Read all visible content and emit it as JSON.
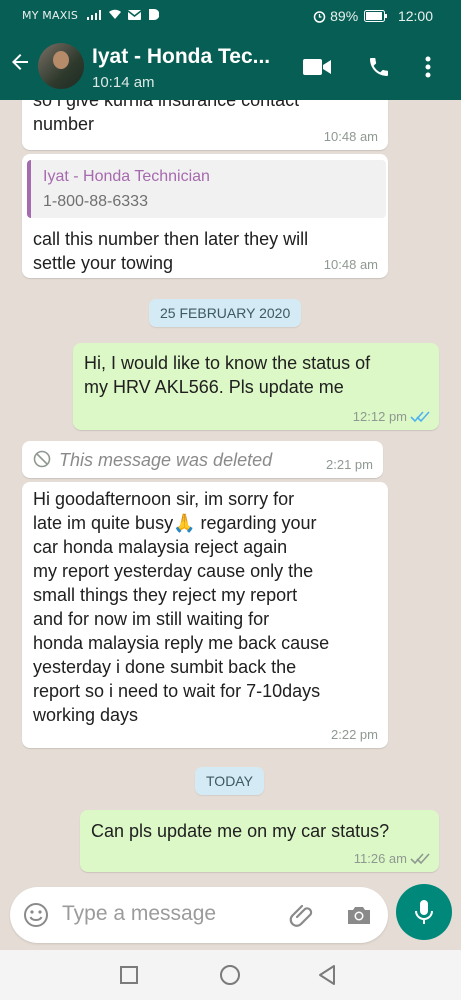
{
  "status_bar": {
    "carrier": "MY MAXIS",
    "battery": "89%",
    "time": "12:00"
  },
  "header": {
    "contact_name": "Iyat - Honda Tec...",
    "subtitle": "10:14 am"
  },
  "messages": [
    {
      "direction": "incoming",
      "text": "so i give kurnia insurance contact\nnumber",
      "time": "10:48 am"
    },
    {
      "direction": "incoming",
      "quoted": {
        "name": "Iyat - Honda Technician",
        "text": "1-800-88-6333"
      },
      "text": "call this number then later they will\nsettle your towing",
      "time": "10:48 am"
    },
    {
      "type": "date",
      "label": "25 FEBRUARY 2020"
    },
    {
      "direction": "outgoing",
      "text": "Hi, I would like to know the status of\nmy HRV AKL566. Pls update me",
      "time": "12:12 pm",
      "status": "read"
    },
    {
      "direction": "incoming",
      "deleted": true,
      "text": "This message was deleted",
      "time": "2:21 pm"
    },
    {
      "direction": "incoming",
      "text": "Hi goodafternoon sir, im sorry for\nlate im quite busy🙏 regarding your\ncar honda malaysia reject again\nmy report yesterday cause only the\nsmall things they reject my report\nand for now im still waiting for\nhonda malaysia reply me back cause\nyesterday i done sumbit back the\nreport so i need to wait for 7-10days\nworking days",
      "time": "2:22 pm"
    },
    {
      "type": "date",
      "label": "TODAY"
    },
    {
      "direction": "outgoing",
      "text": "Can pls update me on my car status?",
      "time": "11:26 am",
      "status": "delivered"
    }
  ],
  "composer": {
    "placeholder": "Type a message"
  },
  "colors": {
    "header": "#075e54",
    "chat_bg": "#e5ddd5",
    "outgoing_bubble": "#dcf8c6",
    "incoming_bubble": "#ffffff",
    "read_ticks": "#4fb3f0",
    "mic_button": "#00897b",
    "date_chip": "#d4eaf4",
    "quote_name": "#a66aaf"
  },
  "icons": {
    "status_bar": [
      "signal-icon",
      "wifi-icon",
      "email-icon",
      "notification-icon",
      "alarm-icon",
      "battery-icon"
    ],
    "header": [
      "back-arrow-icon",
      "video-call-icon",
      "phone-icon",
      "more-vert-icon"
    ],
    "composer": [
      "emoji-icon",
      "attach-icon",
      "camera-icon",
      "mic-icon"
    ],
    "navbar": [
      "recents-square-icon",
      "home-circle-icon",
      "back-triangle-icon"
    ]
  }
}
